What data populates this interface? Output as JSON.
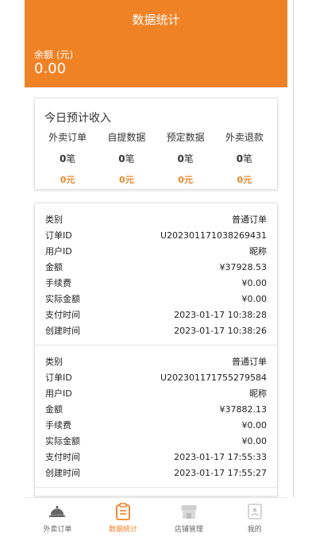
{
  "header": {
    "title": "数据统计",
    "balance_label": "余额 (元)",
    "balance_value": "0.00"
  },
  "income": {
    "title": "今日预计收入",
    "columns": [
      {
        "label": "外卖订单",
        "count": "0",
        "unit": "笔",
        "amount": "0元"
      },
      {
        "label": "自提数据",
        "count": "0",
        "unit": "笔",
        "amount": "0元"
      },
      {
        "label": "预定数据",
        "count": "0",
        "unit": "笔",
        "amount": "0元"
      },
      {
        "label": "外卖退款",
        "count": "0",
        "unit": "笔",
        "amount": "0元"
      }
    ]
  },
  "order_fields": [
    "类别",
    "订单ID",
    "用户ID",
    "金额",
    "手续费",
    "实际金额",
    "支付时间",
    "创建时间"
  ],
  "orders": [
    {
      "values": [
        "普通订单",
        "U202301171038269431",
        "昵称",
        "¥37928.53",
        "¥0.00",
        "¥0.00",
        "2023-01-17 10:38:28",
        "2023-01-17 10:38:26"
      ]
    },
    {
      "values": [
        "普通订单",
        "U202301171755279584",
        "昵称",
        "¥37882.13",
        "¥0.00",
        "¥0.00",
        "2023-01-17 17:55:33",
        "2023-01-17 17:55:27"
      ]
    }
  ],
  "tabbar": {
    "items": [
      {
        "label": "外卖订单",
        "icon": "cloche-icon",
        "active": false
      },
      {
        "label": "数据统计",
        "icon": "clipboard-icon",
        "active": true
      },
      {
        "label": "店铺管理",
        "icon": "store-icon",
        "active": false
      },
      {
        "label": "我的",
        "icon": "profile-icon",
        "active": false
      }
    ]
  },
  "colors": {
    "accent": "#f08226",
    "amount": "#e8882a",
    "inactive_icon": "#c9c9c9"
  }
}
